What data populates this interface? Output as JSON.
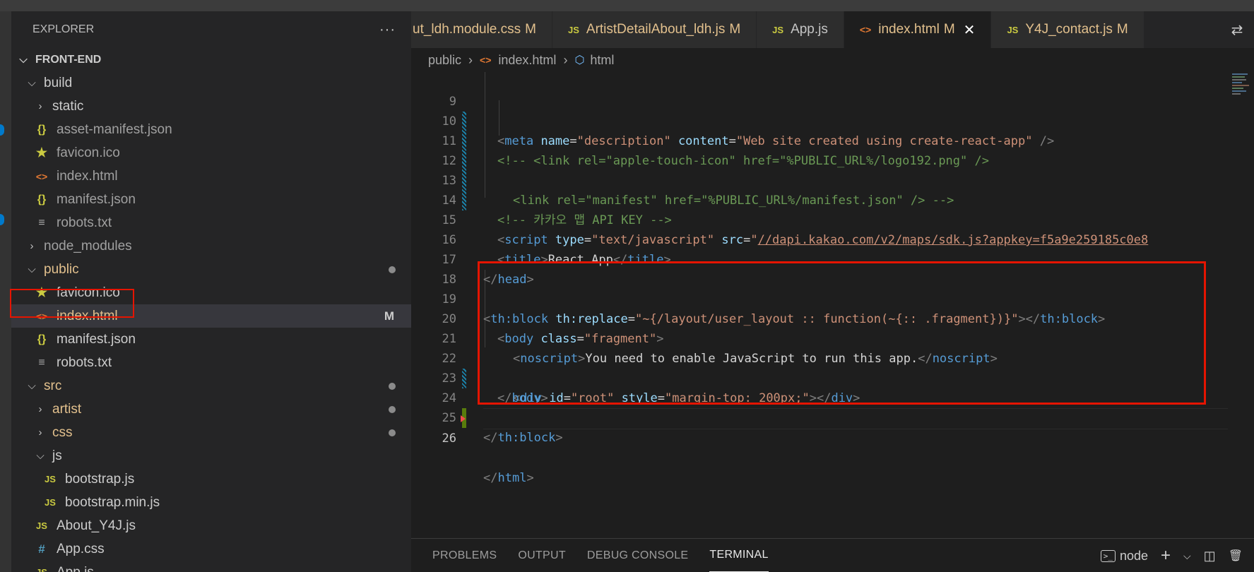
{
  "sidebar": {
    "title": "EXPLORER",
    "more": "···",
    "items": [
      {
        "label": "FRONT-END",
        "caret": "⌵",
        "icon": ""
      },
      {
        "label": "build",
        "caret": "⌵",
        "icon": ""
      },
      {
        "label": "static",
        "caret": "›",
        "icon": ""
      },
      {
        "label": "asset-manifest.json",
        "icon": "{}"
      },
      {
        "label": "favicon.ico",
        "icon": "★"
      },
      {
        "label": "index.html",
        "icon": "<>"
      },
      {
        "label": "manifest.json",
        "icon": "{}"
      },
      {
        "label": "robots.txt",
        "icon": "≡"
      },
      {
        "label": "node_modules",
        "caret": "›",
        "icon": ""
      },
      {
        "label": "public",
        "caret": "⌵",
        "icon": ""
      },
      {
        "label": "favicon.ico",
        "icon": "★"
      },
      {
        "label": "index.html",
        "icon": "<>",
        "badge": "M"
      },
      {
        "label": "manifest.json",
        "icon": "{}"
      },
      {
        "label": "robots.txt",
        "icon": "≡"
      },
      {
        "label": "src",
        "caret": "⌵",
        "icon": ""
      },
      {
        "label": "artist",
        "caret": "›",
        "icon": ""
      },
      {
        "label": "css",
        "caret": "›",
        "icon": ""
      },
      {
        "label": "js",
        "caret": "⌵",
        "icon": ""
      },
      {
        "label": "bootstrap.js",
        "icon": "JS"
      },
      {
        "label": "bootstrap.min.js",
        "icon": "JS"
      },
      {
        "label": "About_Y4J.js",
        "icon": "JS"
      },
      {
        "label": "App.css",
        "icon": "#"
      },
      {
        "label": "App.js",
        "icon": "JS"
      }
    ]
  },
  "tabs": [
    {
      "label": "ut_ldh.module.css",
      "icon": "",
      "mod": "M"
    },
    {
      "label": "ArtistDetailAbout_ldh.js",
      "icon": "JS",
      "mod": "M"
    },
    {
      "label": "App.js",
      "icon": "JS",
      "mod": ""
    },
    {
      "label": "index.html",
      "icon": "<>",
      "mod": "M",
      "close": "✕"
    },
    {
      "label": "Y4J_contact.js",
      "icon": "JS",
      "mod": "M"
    }
  ],
  "breadcrumb": {
    "p1": "public",
    "p2": "index.html",
    "p3": "html",
    "sep": "›",
    "html_icon": "<>",
    "cube_icon": "⬡"
  },
  "editor": {
    "line_numbers": [
      "9",
      "10",
      "11",
      "12",
      "13",
      "14",
      "15",
      "16",
      "17",
      "18",
      "19",
      "20",
      "21",
      "22",
      "23",
      "24",
      "25",
      "26"
    ],
    "l9": {
      "t1": "<",
      "tag": "meta",
      "a1": " name",
      "eq": "=",
      "s1": "\"description\"",
      "a2": " content",
      "s2": "\"Web site created using create-react-app\"",
      "end": " />"
    },
    "l10": "<!-- <link rel=\"apple-touch-icon\" href=\"%PUBLIC_URL%/logo192.png\" />",
    "l12": "<link rel=\"manifest\" href=\"%PUBLIC_URL%/manifest.json\" /> -->",
    "l14": "<!-- 카카오 맵 API KEY -->",
    "l15": {
      "t1": "<",
      "tag": "script",
      "a1": " type",
      "s1": "\"text/javascript\"",
      "a2": " src",
      "q": "\"",
      "url": "//dapi.kakao.com/v2/maps/sdk.js?appkey=f5a9e259185c0e8"
    },
    "l16": {
      "tag": "title",
      "text": "React App"
    },
    "l17": {
      "tag": "head"
    },
    "l19": {
      "tag": "th:block",
      "attr": " th:replace",
      "str": "\"~{/layout/user_layout :: function(~{:: .fragment})}\""
    },
    "l20": {
      "tag": "body",
      "attr": " class",
      "str": "\"fragment\""
    },
    "l21": {
      "tag": "noscript",
      "text": "You need to enable JavaScript to run this app."
    },
    "l22": {
      "tag": "div",
      "a1": " id",
      "s1": "\"root\"",
      "a2": " style",
      "s2": "\"margin-top: 200px;\""
    },
    "l23": {
      "tag": "body"
    },
    "l24": {
      "tag": "th:block"
    },
    "l26": {
      "tag": "html"
    }
  },
  "panel": {
    "tabs": [
      "PROBLEMS",
      "OUTPUT",
      "DEBUG CONSOLE",
      "TERMINAL"
    ],
    "terminal_name": "node",
    "plus": "+",
    "chevron": "⌵",
    "split": "◫",
    "trash": "🗑"
  },
  "colors": {
    "highlight_box": "#e51400",
    "tag": "#569cd6",
    "attr": "#9cdcfe",
    "string": "#ce9178",
    "comment": "#6a9955"
  }
}
